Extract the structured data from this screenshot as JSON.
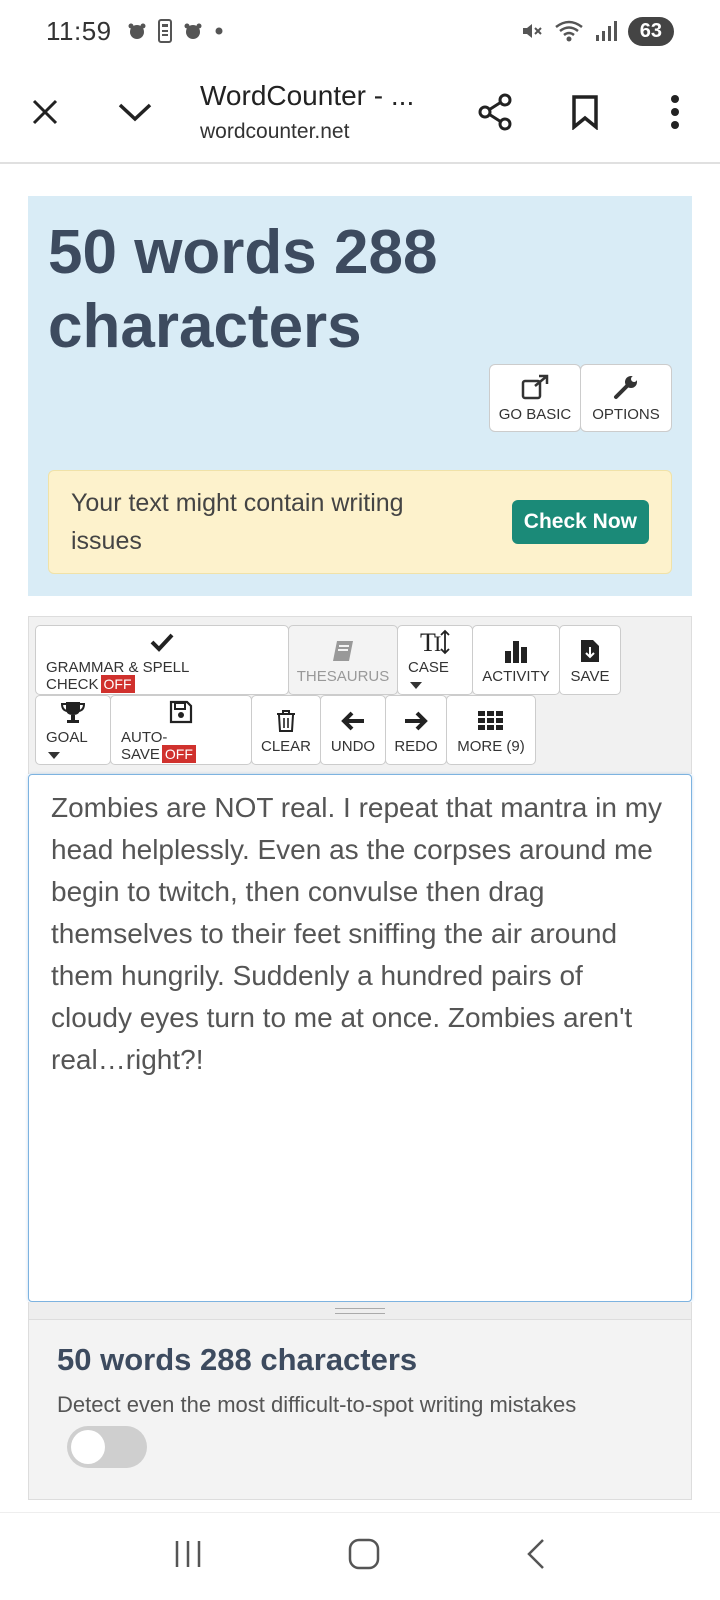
{
  "status_bar": {
    "time": "11:59",
    "battery": "63"
  },
  "browser": {
    "title": "WordCounter - ...",
    "url": "wordcounter.net"
  },
  "hero": {
    "count_text": "50 words 288 characters",
    "go_basic_label": "GO BASIC",
    "options_label": "OPTIONS",
    "notice_text": "Your text might contain writing issues",
    "check_now_label": "Check Now"
  },
  "toolbar": {
    "row1": {
      "grammar_label": "GRAMMAR & SPELL CHECK",
      "grammar_state": "OFF",
      "thesaurus_label": "THESAURUS",
      "case_label": "CASE",
      "activity_label": "ACTIVITY",
      "save_label": "SAVE"
    },
    "row2": {
      "goal_label": "GOAL",
      "autosave_label": "AUTO-SAVE",
      "autosave_state": "OFF",
      "clear_label": "CLEAR",
      "undo_label": "UNDO",
      "redo_label": "REDO",
      "more_label": "MORE (9)"
    }
  },
  "editor": {
    "text": "Zombies are NOT real. I repeat that mantra in my head helplessly. Even as the corpses around me begin to twitch, then convulse then drag themselves to their feet sniffing the air around them hungrily. Suddenly a hundred pairs of cloudy eyes turn to me at once. Zombies aren't real…right?!"
  },
  "summary": {
    "count_text": "50 words 288 characters",
    "description": "Detect even the most difficult-to-spot writing mistakes",
    "toggle_on": false
  },
  "colors": {
    "hero_bg": "#d9ecf6",
    "heading": "#3d4b5f",
    "accent_green": "#1b8a78",
    "off_red": "#d0312d",
    "notice_bg": "#fdf2cc"
  }
}
